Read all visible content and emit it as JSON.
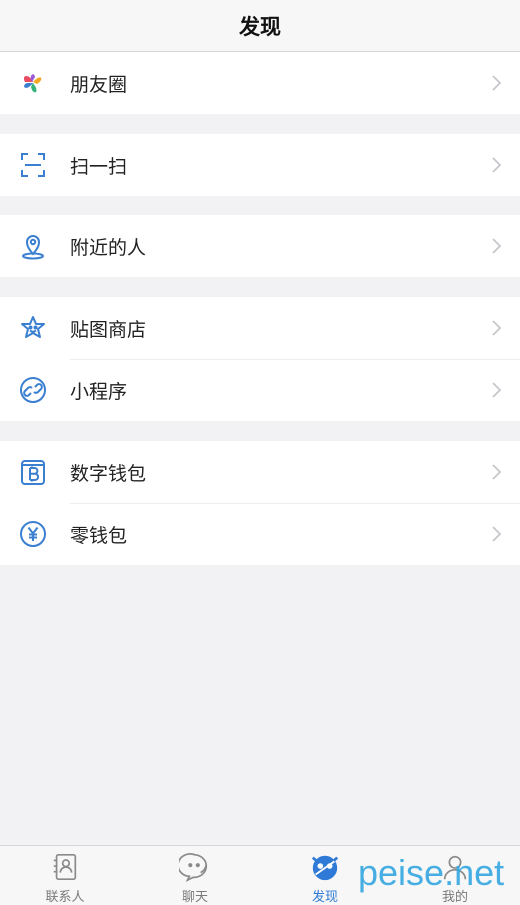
{
  "header": {
    "title": "发现"
  },
  "groups": [
    {
      "items": [
        {
          "label": "朋友圈",
          "icon": "moments-icon"
        }
      ]
    },
    {
      "items": [
        {
          "label": "扫一扫",
          "icon": "scan-icon"
        }
      ]
    },
    {
      "items": [
        {
          "label": "附近的人",
          "icon": "location-pin-icon"
        }
      ]
    },
    {
      "items": [
        {
          "label": "贴图商店",
          "icon": "sticker-star-icon"
        },
        {
          "label": "小程序",
          "icon": "mini-program-icon"
        }
      ]
    },
    {
      "items": [
        {
          "label": "数字钱包",
          "icon": "bitcoin-wallet-icon"
        },
        {
          "label": "零钱包",
          "icon": "yen-coin-icon"
        }
      ]
    }
  ],
  "tabbar": {
    "tabs": [
      {
        "label": "联系人",
        "icon": "contacts-icon",
        "active": false
      },
      {
        "label": "聊天",
        "icon": "chat-icon",
        "active": false
      },
      {
        "label": "发现",
        "icon": "discover-icon",
        "active": true
      },
      {
        "label": "我的",
        "icon": "profile-icon",
        "active": false
      }
    ]
  },
  "watermark": {
    "text": "peise.net"
  },
  "colors": {
    "accent": "#2e7ad6",
    "icon_stroke": "#3a7fd0",
    "chevron": "#c7c7cc",
    "background": "#f2f2f4"
  }
}
